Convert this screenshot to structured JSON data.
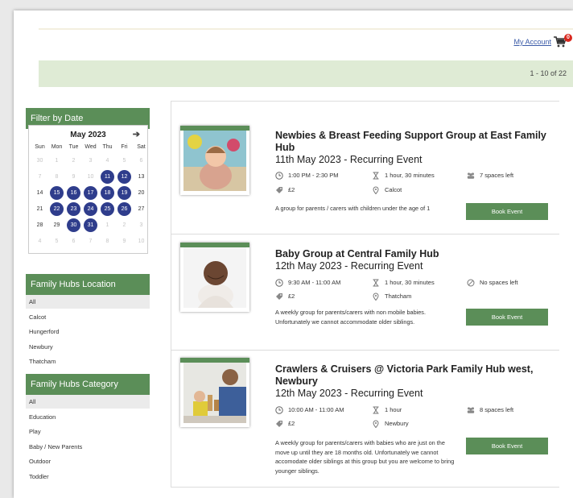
{
  "header": {
    "account_link": "My Account",
    "cart_count": "0",
    "result_count": "1 - 10 of 22"
  },
  "sidebar": {
    "filter_title": "Filter by Date",
    "calendar": {
      "month_label": "May 2023",
      "next_icon": "arrow-right-icon",
      "weekdays": [
        "Sun",
        "Mon",
        "Tue",
        "Wed",
        "Thu",
        "Fri",
        "Sat"
      ],
      "weeks": [
        [
          {
            "d": "30",
            "s": "fade"
          },
          {
            "d": "1",
            "s": "fade"
          },
          {
            "d": "2",
            "s": "fade"
          },
          {
            "d": "3",
            "s": "fade"
          },
          {
            "d": "4",
            "s": "fade"
          },
          {
            "d": "5",
            "s": "fade"
          },
          {
            "d": "6",
            "s": "fade"
          }
        ],
        [
          {
            "d": "7",
            "s": "fade"
          },
          {
            "d": "8",
            "s": "fade"
          },
          {
            "d": "9",
            "s": "fade"
          },
          {
            "d": "10",
            "s": "fade"
          },
          {
            "d": "11",
            "s": "ev"
          },
          {
            "d": "12",
            "s": "ev"
          },
          {
            "d": "13",
            "s": "cur"
          }
        ],
        [
          {
            "d": "14",
            "s": "cur"
          },
          {
            "d": "15",
            "s": "ev"
          },
          {
            "d": "16",
            "s": "ev"
          },
          {
            "d": "17",
            "s": "ev"
          },
          {
            "d": "18",
            "s": "ev"
          },
          {
            "d": "19",
            "s": "ev"
          },
          {
            "d": "20",
            "s": "cur"
          }
        ],
        [
          {
            "d": "21",
            "s": "cur"
          },
          {
            "d": "22",
            "s": "ev"
          },
          {
            "d": "23",
            "s": "ev"
          },
          {
            "d": "24",
            "s": "ev"
          },
          {
            "d": "25",
            "s": "ev"
          },
          {
            "d": "26",
            "s": "ev"
          },
          {
            "d": "27",
            "s": "cur"
          }
        ],
        [
          {
            "d": "28",
            "s": "cur"
          },
          {
            "d": "29",
            "s": "cur"
          },
          {
            "d": "30",
            "s": "ev"
          },
          {
            "d": "31",
            "s": "ev"
          },
          {
            "d": "1",
            "s": "fade"
          },
          {
            "d": "2",
            "s": "fade"
          },
          {
            "d": "3",
            "s": "fade"
          }
        ],
        [
          {
            "d": "4",
            "s": "fade"
          },
          {
            "d": "5",
            "s": "fade"
          },
          {
            "d": "6",
            "s": "fade"
          },
          {
            "d": "7",
            "s": "fade"
          },
          {
            "d": "8",
            "s": "fade"
          },
          {
            "d": "9",
            "s": "fade"
          },
          {
            "d": "10",
            "s": "fade"
          }
        ]
      ]
    },
    "location_title": "Family Hubs Location",
    "locations": [
      "All",
      "Calcot",
      "Hungerford",
      "Newbury",
      "Thatcham"
    ],
    "category_title": "Family Hubs Category",
    "categories": [
      "All",
      "Education",
      "Play",
      "Baby / New Parents",
      "Outdoor",
      "Toddler"
    ]
  },
  "events": [
    {
      "title": "Newbies & Breast Feeding Support Group at East Family Hub",
      "subtitle": "11th May 2023 - Recurring Event",
      "time": "1:00 PM - 2:30 PM",
      "duration": "1 hour, 30 minutes",
      "spaces": "7 spaces left",
      "price": "£2",
      "location": "Calcot",
      "description": "A group for parents / carers with children under the age of 1",
      "button": "Book Event"
    },
    {
      "title": "Baby Group at Central Family Hub",
      "subtitle": "12th May 2023 - Recurring Event",
      "time": "9:30 AM - 11:00 AM",
      "duration": "1 hour, 30 minutes",
      "spaces": "No spaces left",
      "price": "£2",
      "location": "Thatcham",
      "description": "A weekly group for parents/carers with non mobile babies. Unfortunately we cannot accommodate older siblings.",
      "button": "Book Event"
    },
    {
      "title": "Crawlers & Cruisers @ Victoria Park Family Hub west, Newbury",
      "subtitle": "12th May 2023 - Recurring Event",
      "time": "10:00 AM - 11:00 AM",
      "duration": "1 hour",
      "spaces": "8 spaces left",
      "price": "£2",
      "location": "Newbury",
      "description": "A weekly group for parents/carers with babies who are just on the move up until they are 18 months old. Unfortunately we cannot accomodate older siblings at this group but you are welcome to bring younger siblings.",
      "button": "Book Event"
    }
  ]
}
